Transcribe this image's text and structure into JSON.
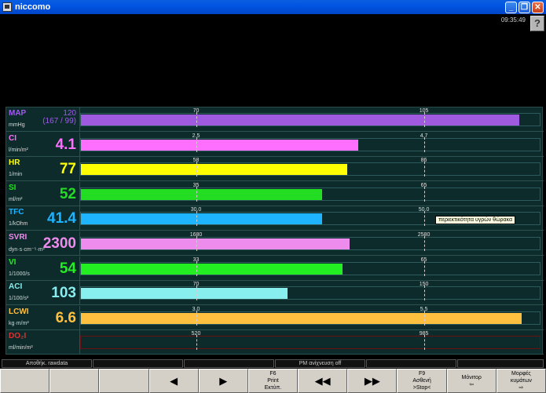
{
  "window": {
    "title": "niccomo"
  },
  "clock": "09:35:49",
  "help_label": "?",
  "tooltip": "περιεκτικότητα υγρών θώρακα",
  "parameters": [
    {
      "name": "MAP",
      "unit": "mmHg",
      "value": "120",
      "value2": "(167 / 99)",
      "color": "#a05af0",
      "fill_color": "#a05ae0",
      "fill_fraction": 0.955,
      "tick_low": "70",
      "tick_high": "105",
      "tick_low_pos": 0.25,
      "tick_high_pos": 0.745
    },
    {
      "name": "CI",
      "unit": "l/min/m²",
      "value": "4.1",
      "color": "#ff6fff",
      "fill_color": "#ff6fff",
      "fill_fraction": 0.605,
      "tick_low": "2.5",
      "tick_high": "4.7",
      "tick_low_pos": 0.25,
      "tick_high_pos": 0.745
    },
    {
      "name": "HR",
      "unit": "1/min",
      "value": "77",
      "color": "#ffff00",
      "fill_color": "#ffff00",
      "fill_fraction": 0.58,
      "tick_low": "58",
      "tick_high": "86",
      "tick_low_pos": 0.25,
      "tick_high_pos": 0.745
    },
    {
      "name": "SI",
      "unit": "ml/m²",
      "value": "52",
      "color": "#22dd22",
      "fill_color": "#22dd22",
      "fill_fraction": 0.525,
      "tick_low": "35",
      "tick_high": "65",
      "tick_low_pos": 0.25,
      "tick_high_pos": 0.745
    },
    {
      "name": "TFC",
      "unit": "1/kOhm",
      "value": "41.4",
      "color": "#1eb4ff",
      "fill_color": "#1eb4ff",
      "fill_fraction": 0.525,
      "tick_low": "30.0",
      "tick_high": "50.0",
      "tick_low_pos": 0.25,
      "tick_high_pos": 0.745
    },
    {
      "name": "SVRI",
      "unit": "dyn·s·cm⁻⁵·m²",
      "value": "2300",
      "color": "#ee8cee",
      "fill_color": "#ee8cee",
      "fill_fraction": 0.585,
      "tick_low": "1680",
      "tick_high": "2580",
      "tick_low_pos": 0.25,
      "tick_high_pos": 0.745
    },
    {
      "name": "VI",
      "unit": "1/1000/s",
      "value": "54",
      "color": "#22ee22",
      "fill_color": "#22ee22",
      "fill_fraction": 0.57,
      "tick_low": "33",
      "tick_high": "65",
      "tick_low_pos": 0.25,
      "tick_high_pos": 0.745
    },
    {
      "name": "ACI",
      "unit": "1/100/s²",
      "value": "103",
      "color": "#88eeee",
      "fill_color": "#88eeee",
      "fill_fraction": 0.45,
      "tick_low": "70",
      "tick_high": "150",
      "tick_low_pos": 0.25,
      "tick_high_pos": 0.745
    },
    {
      "name": "LCWI",
      "unit": "kg·m/m²",
      "value": "6.6",
      "color": "#ffc040",
      "fill_color": "#ffc040",
      "fill_fraction": 0.96,
      "tick_low": "3.0",
      "tick_high": "5.5",
      "tick_low_pos": 0.25,
      "tick_high_pos": 0.745
    },
    {
      "name": "DO₂I",
      "unit": "ml/min/m²",
      "value": "",
      "color": "#e03030",
      "fill_color": "#e03030",
      "fill_fraction": 0,
      "tick_low": "520",
      "tick_high": "985",
      "tick_low_pos": 0.25,
      "tick_high_pos": 0.745,
      "track_border": "#6a1010"
    }
  ],
  "status_cells": [
    {
      "text": ""
    },
    {
      "text": "Αποθήκ. rawdata"
    },
    {
      "text": ""
    },
    {
      "text": ""
    },
    {
      "text": "PM ανίχνευση off"
    },
    {
      "text": ""
    },
    {
      "text": ""
    },
    {
      "text": ""
    }
  ],
  "function_keys": [
    {
      "line1": "",
      "line2": "",
      "line3": "",
      "name": "fkey-empty-1"
    },
    {
      "line1": "",
      "line2": "",
      "line3": "",
      "name": "fkey-empty-2"
    },
    {
      "line1": "",
      "line2": "",
      "line3": "",
      "name": "fkey-empty-3"
    },
    {
      "line1": "◀",
      "line2": "",
      "line3": "",
      "name": "prev-button",
      "arrow": true
    },
    {
      "line1": "▶",
      "line2": "",
      "line3": "",
      "name": "next-button",
      "arrow": true
    },
    {
      "line1": "F6",
      "line2": "Print",
      "line3": "Εκτύπ.",
      "name": "print-button"
    },
    {
      "line1": "◀◀",
      "line2": "",
      "line3": "",
      "name": "rewind-button",
      "arrow": true
    },
    {
      "line1": "▶▶",
      "line2": "",
      "line3": "",
      "name": "forward-button",
      "arrow": true
    },
    {
      "line1": "F9",
      "line2": "Ασθενή",
      "line3": ">Stop<",
      "name": "patient-stop-button"
    },
    {
      "line1": "Μόνιτορ",
      "line2": "⇦",
      "line3": "",
      "name": "monitor-button"
    },
    {
      "line1": "Μορφές",
      "line2": "κυμάτων",
      "line3": "⇨",
      "name": "waveforms-button"
    }
  ]
}
